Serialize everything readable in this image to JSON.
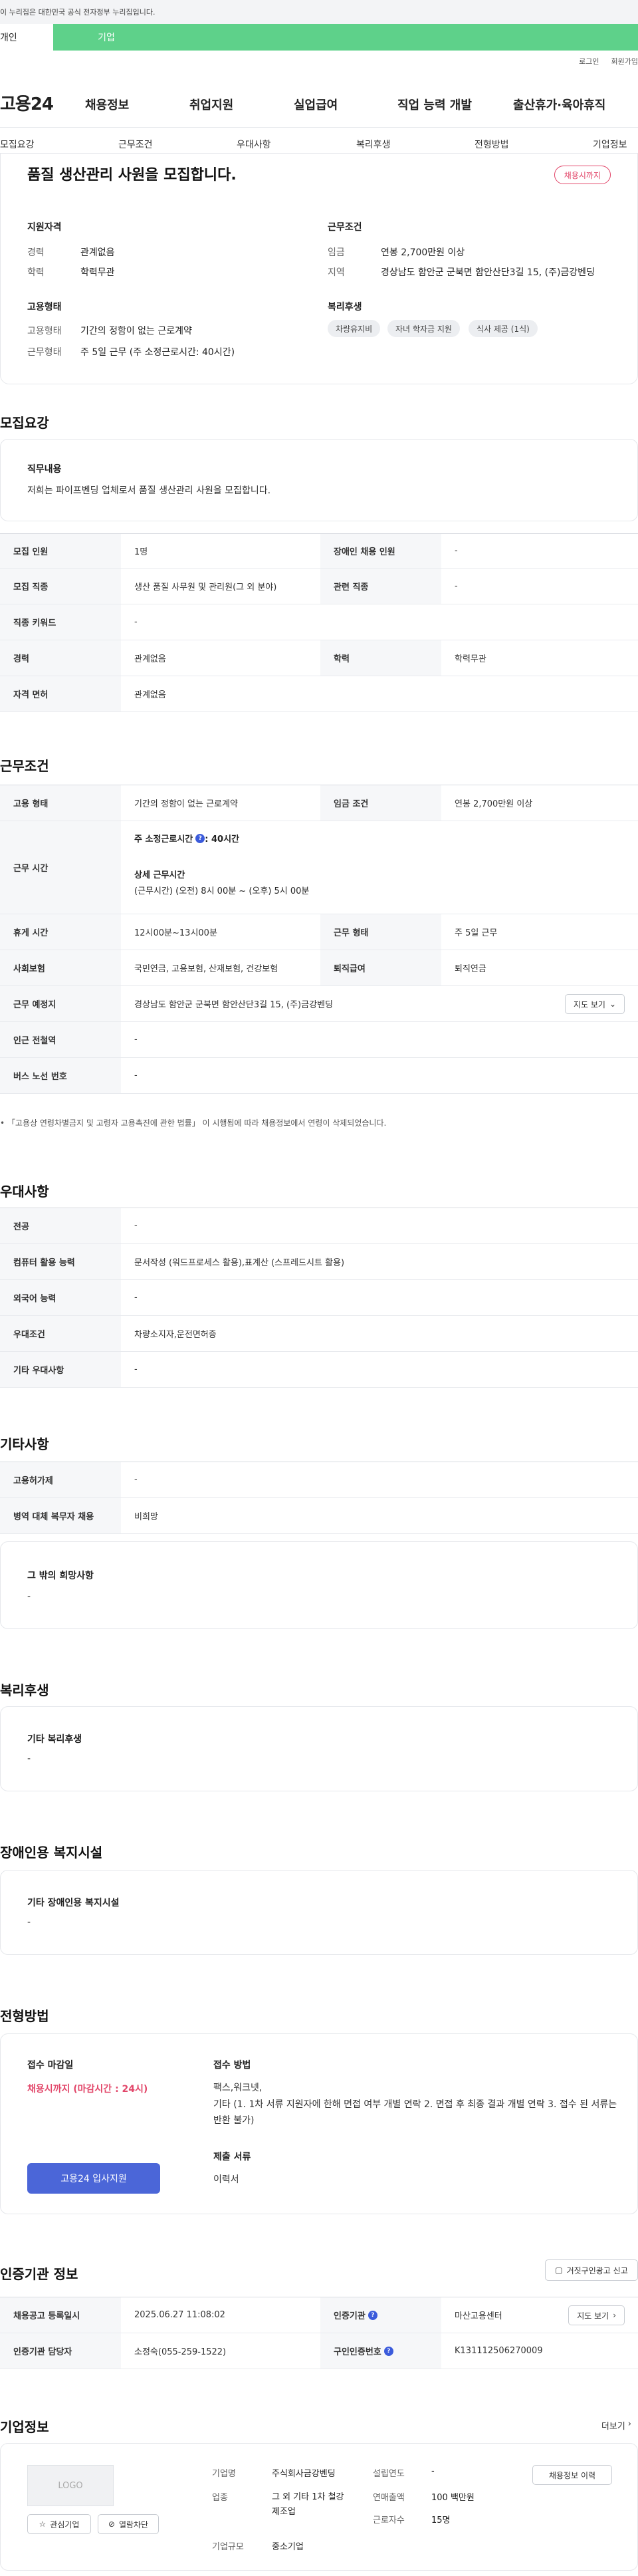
{
  "gov_banner": "이 누리집은 대한민국 공식 전자정부 누리집입니다.",
  "user_tabs": {
    "personal": "개인",
    "corporate": "기업"
  },
  "util": {
    "login": "로그인",
    "signup": "회원가입"
  },
  "logo": "고용24",
  "gnb": [
    "채용정보",
    "취업지원",
    "실업급여",
    "직업 능력 개발",
    "출산휴가·육아휴직"
  ],
  "subtabs": [
    "모집요강",
    "근무조건",
    "우대사항",
    "복리후생",
    "전형방법",
    "기업정보"
  ],
  "headline": {
    "title": "품질 생산관리 사원을 모집합니다.",
    "status_badge": "채용시까지",
    "qual_title": "지원자격",
    "qual": [
      {
        "k": "경력",
        "v": "관계없음"
      },
      {
        "k": "학력",
        "v": "학력무관"
      }
    ],
    "cond_title": "근무조건",
    "cond": [
      {
        "k": "임금",
        "v": "연봉 2,700만원 이상"
      },
      {
        "k": "지역",
        "v": "경상남도 함안군 군북면 함안산단3길 15, (주)금강벤딩"
      }
    ],
    "emp_title": "고용형태",
    "emp": [
      {
        "k": "고용형태",
        "v": "기간의 정함이 없는 근로계약"
      },
      {
        "k": "근무형태",
        "v": "주 5일 근무 (주 소정근로시간: 40시간)"
      }
    ],
    "welfare_title": "복리후생",
    "welfare_chips": [
      "차량유지비",
      "자녀 학자금 지원",
      "식사 제공 (1식)"
    ]
  },
  "recruit": {
    "title": "모집요강",
    "job_desc_label": "직무내용",
    "job_desc": "저희는 파이프벤딩 업체로서 품질 생산관리 사원을 모집합니다.",
    "rows": [
      {
        "k1": "모집 인원",
        "v1": "1명",
        "k2": "장애인 채용 인원",
        "v2": "-"
      },
      {
        "k1": "모집 직종",
        "v1": "생산 품질 사무원 및 관리원(그 외 분야)",
        "k2": "관련 직종",
        "v2": "-"
      },
      {
        "k1": "직종 키워드",
        "v1": "-"
      },
      {
        "k1": "경력",
        "v1": "관계없음",
        "k2": "학력",
        "v2": "학력무관"
      },
      {
        "k1": "자격 면허",
        "v1": "관계없음"
      }
    ]
  },
  "work": {
    "title": "근무조건",
    "emp_type_k": "고용 형태",
    "emp_type_v": "기간의 정함이 없는 근로계약",
    "wage_k": "임금 조건",
    "wage_v": "연봉 2,700만원 이상",
    "hours_k": "근무 시간",
    "hours_main": "주 소정근로시간",
    "hours_main_val": ": 40시간",
    "hours_detail_label": "상세 근무시간",
    "hours_detail": "(근무시간) (오전) 8시 00분 ~ (오후) 5시 00분",
    "break_k": "휴게 시간",
    "break_v": "12시00분~13시00분",
    "form_k": "근무 형태",
    "form_v": "주 5일 근무",
    "ins_k": "사회보험",
    "ins_v": "국민연금, 고용보험, 산재보험, 건강보험",
    "retire_k": "퇴직급여",
    "retire_v": "퇴직연금",
    "place_k": "근무 예정지",
    "place_v": "경상남도 함안군 군북면 함안산단3길 15, (주)금강벤딩",
    "map_btn": "지도 보기",
    "subway_k": "인근 전철역",
    "subway_v": "-",
    "bus_k": "버스 노선 번호",
    "bus_v": "-",
    "notice": "「고용상 연령차별금지 및 고령자 고용촉진에 관한 법률」 이 시행됨에 따라 채용정보에서 연령이 삭제되었습니다."
  },
  "pref": {
    "title": "우대사항",
    "rows": [
      {
        "k": "전공",
        "v": "-"
      },
      {
        "k": "컴퓨터 활용 능력",
        "v": "문서작성 (워드프로세스 활용),표계산 (스프레드시트 활용)"
      },
      {
        "k": "외국어 능력",
        "v": "-"
      },
      {
        "k": "우대조건",
        "v": "차량소지자,운전면허증"
      },
      {
        "k": "기타 우대사항",
        "v": "-"
      }
    ]
  },
  "etc": {
    "title": "기타사항",
    "rows": [
      {
        "k": "고용허가제",
        "v": "-"
      },
      {
        "k": "병역 대체 복무자 채용",
        "v": "비희망"
      }
    ],
    "other_label": "그 밖의 희망사항",
    "other_value": "-"
  },
  "welfare": {
    "title": "복리후생",
    "label": "기타 복리후생",
    "value": "-"
  },
  "disabled": {
    "title": "장애인용 복지시설",
    "label": "기타 장애인용 복지시설",
    "value": "-"
  },
  "screening": {
    "title": "전형방법",
    "deadline_label": "접수 마감일",
    "deadline_value": "채용시까지 (마감시간 : 24시)",
    "apply_btn": "고용24 입사지원",
    "method_label": "접수 방법",
    "method_line1": "팩스,워크넷,",
    "method_line2": "기타 (1. 1차 서류 지원자에 한해 면접 여부 개별 연락 2. 면접 후 최종 결과 개별 연락 3. 접수 된 서류는 반환 불가)",
    "docs_label": "제출 서류",
    "docs_value": "이력서"
  },
  "agency": {
    "title": "인증기관 정보",
    "report_btn": "거짓구인광고 신고",
    "rows": [
      {
        "k1": "채용공고 등록일시",
        "v1": "2025.06.27 11:08:02",
        "k2": "인증기관",
        "v2": "마산고용센터"
      },
      {
        "k1": "인증기관 담당자",
        "v1": "소정숙(055-259-1522)",
        "k2": "구인인증번호",
        "v2": "K131112506270009"
      }
    ],
    "map_btn": "지도 보기"
  },
  "company": {
    "title": "기업정보",
    "more": "더보기",
    "logo_text": "LOGO",
    "interest_btn": "관심기업",
    "block_btn": "열람차단",
    "name_k": "기업명",
    "name_v": "주식회사금강벤딩",
    "industry_k": "업종",
    "industry_v": "그 외 기타 1차 철강 제조업",
    "size_k": "기업규모",
    "size_v": "중소기업",
    "founded_k": "설립연도",
    "founded_v": "-",
    "sales_k": "연매출액",
    "sales_v": "100 백만원",
    "staff_k": "근로자수",
    "staff_v": "15명",
    "jobs_btn": "채용정보 이력"
  },
  "colors": {
    "brand_green": "#5ed18a",
    "primary_blue": "#4b66d8",
    "alert_red": "#e2476a"
  }
}
